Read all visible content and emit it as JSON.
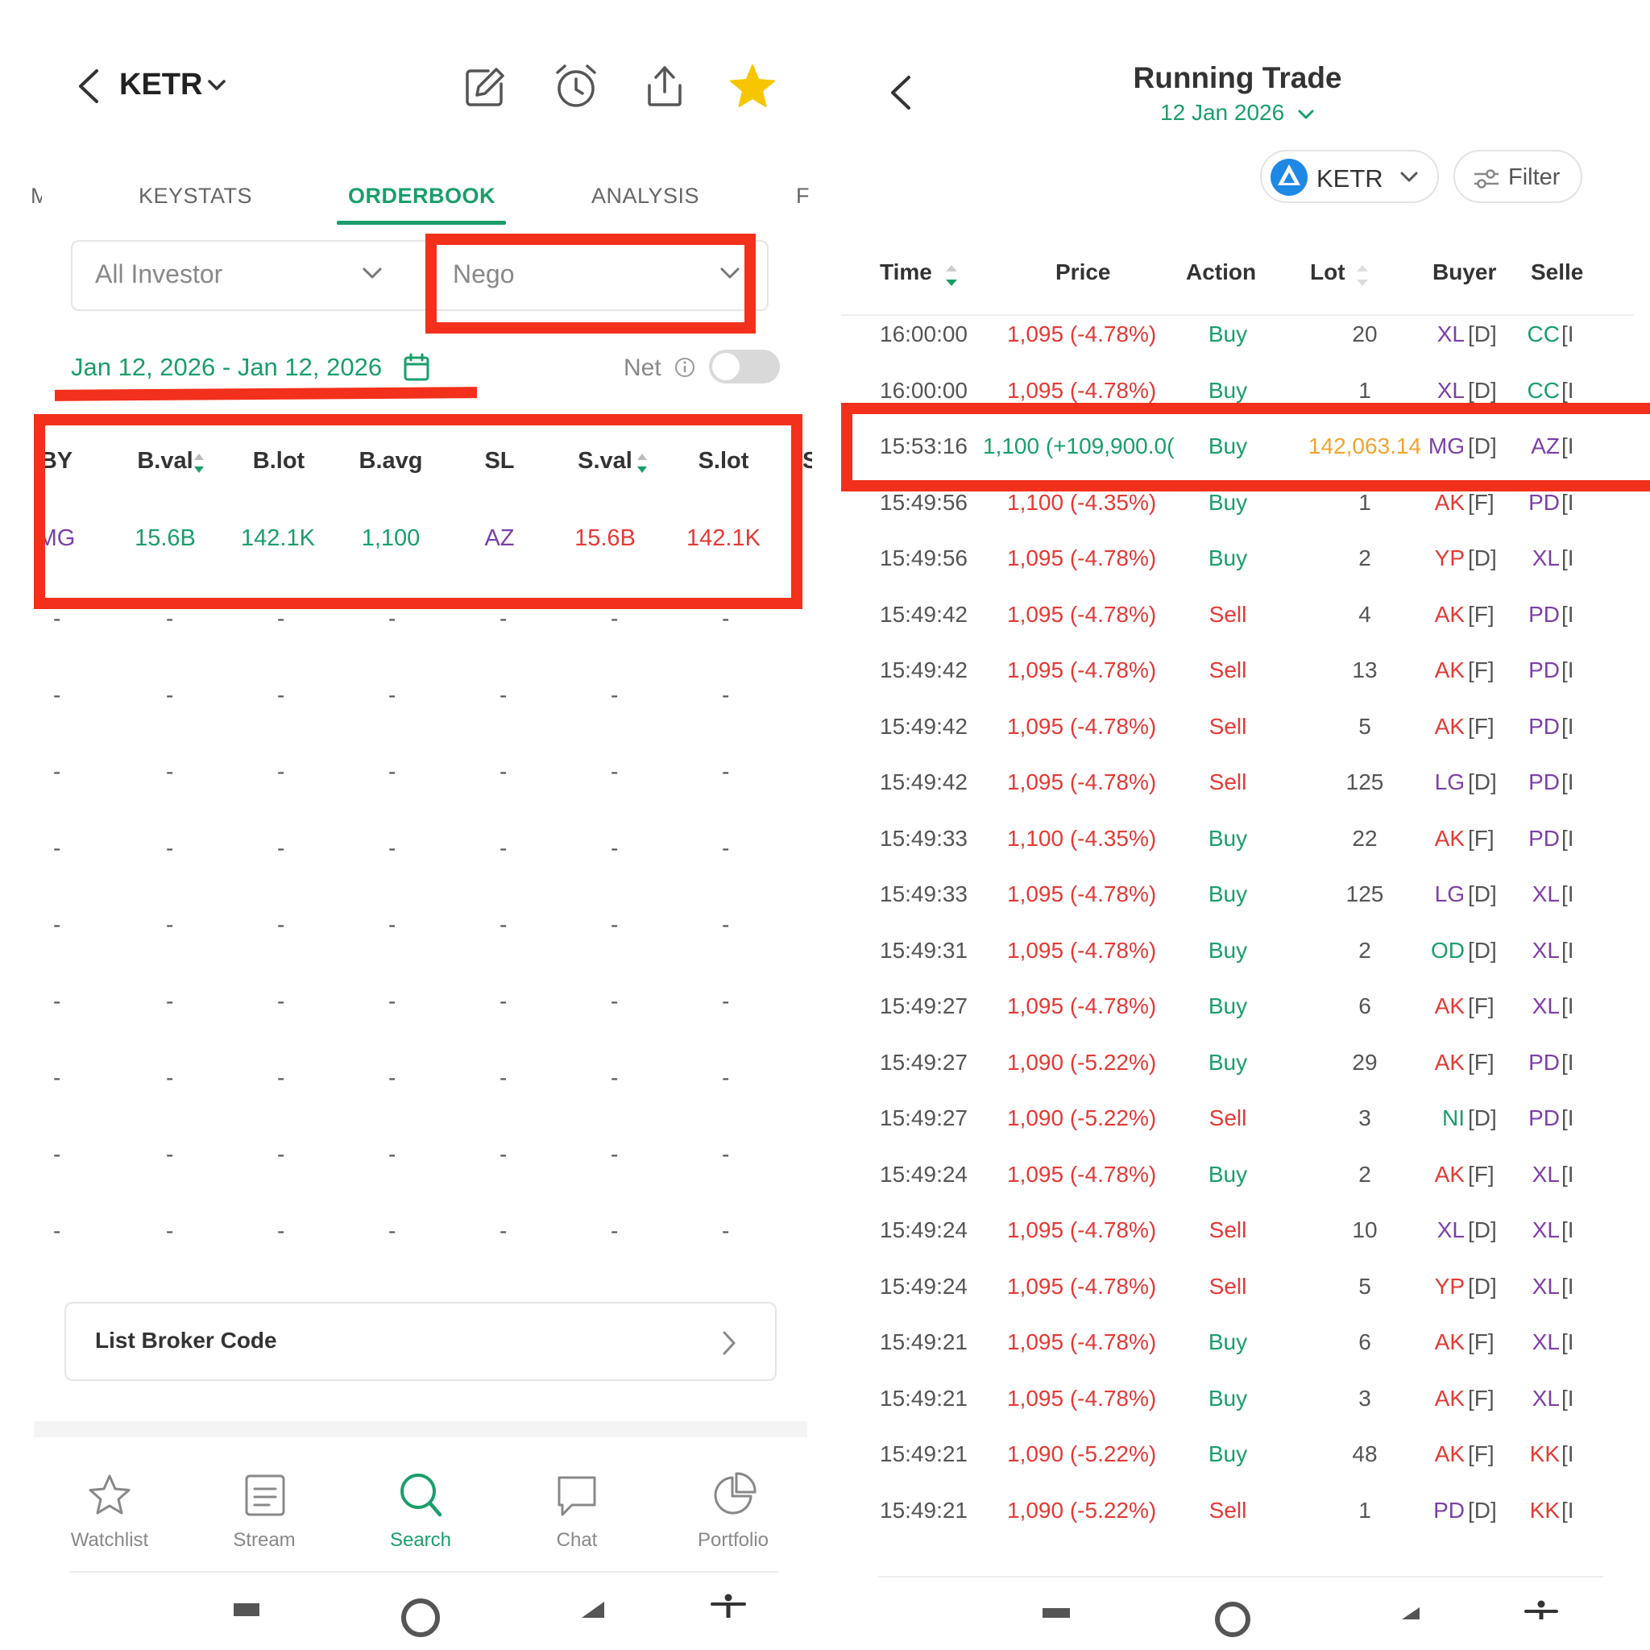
{
  "left": {
    "header": {
      "ticker": "KETR"
    },
    "tabs": [
      {
        "label": "M",
        "active": false
      },
      {
        "label": "KEYSTATS",
        "active": false
      },
      {
        "label": "ORDERBOOK",
        "active": true
      },
      {
        "label": "ANALYSIS",
        "active": false
      },
      {
        "label": "F",
        "active": false
      }
    ],
    "filters": {
      "investor": "All Investor",
      "market": "Nego"
    },
    "date_range": "Jan 12, 2026 - Jan 12, 2026",
    "net_label": "Net",
    "net_on": false,
    "table": {
      "headers": [
        "BY",
        "B.val",
        "B.lot",
        "B.avg",
        "SL",
        "S.val",
        "S.lot",
        "S"
      ],
      "row": [
        "MG",
        "15.6B",
        "142.1K",
        "1,100",
        "AZ",
        "15.6B",
        "142.1K"
      ],
      "dash": "-"
    },
    "list_broker_code": "List Broker Code",
    "nav": [
      {
        "label": "Watchlist",
        "icon": "star-outline-icon"
      },
      {
        "label": "Stream",
        "icon": "stream-icon"
      },
      {
        "label": "Search",
        "icon": "search-icon",
        "active": true
      },
      {
        "label": "Chat",
        "icon": "chat-icon"
      },
      {
        "label": "Portfolio",
        "icon": "pie-chart-icon"
      }
    ]
  },
  "right": {
    "title": "Running Trade",
    "date": "12 Jan 2026",
    "ticker_chip": "KETR",
    "filter_label": "Filter",
    "columns": [
      "Time",
      "Price",
      "Action",
      "Lot",
      "Buyer",
      "Selle"
    ],
    "rows": [
      {
        "time": "16:00:00",
        "price": "1,095 (-4.78%)",
        "action": "Buy",
        "lot": "20",
        "buyer": "XL",
        "buyer_type": "[D]",
        "seller": "CC",
        "seller_type": "[I"
      },
      {
        "time": "16:00:00",
        "price": "1,095 (-4.78%)",
        "action": "Buy",
        "lot": "1",
        "buyer": "XL",
        "buyer_type": "[D]",
        "seller": "CC",
        "seller_type": "[I"
      },
      {
        "time": "15:53:16",
        "price": "1,100 (+109,900.0(",
        "action": "Buy",
        "lot": "142,063.14",
        "buyer": "MG",
        "buyer_type": "[D]",
        "seller": "AZ",
        "seller_type": "[I",
        "highlight": true
      },
      {
        "time": "15:49:56",
        "price": "1,100 (-4.35%)",
        "action": "Buy",
        "lot": "1",
        "buyer": "AK",
        "buyer_type": "[F]",
        "seller": "PD",
        "seller_type": "[I"
      },
      {
        "time": "15:49:56",
        "price": "1,095 (-4.78%)",
        "action": "Buy",
        "lot": "2",
        "buyer": "YP",
        "buyer_type": "[D]",
        "seller": "XL",
        "seller_type": "[I"
      },
      {
        "time": "15:49:42",
        "price": "1,095 (-4.78%)",
        "action": "Sell",
        "lot": "4",
        "buyer": "AK",
        "buyer_type": "[F]",
        "seller": "PD",
        "seller_type": "[I"
      },
      {
        "time": "15:49:42",
        "price": "1,095 (-4.78%)",
        "action": "Sell",
        "lot": "13",
        "buyer": "AK",
        "buyer_type": "[F]",
        "seller": "PD",
        "seller_type": "[I"
      },
      {
        "time": "15:49:42",
        "price": "1,095 (-4.78%)",
        "action": "Sell",
        "lot": "5",
        "buyer": "AK",
        "buyer_type": "[F]",
        "seller": "PD",
        "seller_type": "[I"
      },
      {
        "time": "15:49:42",
        "price": "1,095 (-4.78%)",
        "action": "Sell",
        "lot": "125",
        "buyer": "LG",
        "buyer_type": "[D]",
        "seller": "PD",
        "seller_type": "[I"
      },
      {
        "time": "15:49:33",
        "price": "1,100 (-4.35%)",
        "action": "Buy",
        "lot": "22",
        "buyer": "AK",
        "buyer_type": "[F]",
        "seller": "PD",
        "seller_type": "[I"
      },
      {
        "time": "15:49:33",
        "price": "1,095 (-4.78%)",
        "action": "Buy",
        "lot": "125",
        "buyer": "LG",
        "buyer_type": "[D]",
        "seller": "XL",
        "seller_type": "[I"
      },
      {
        "time": "15:49:31",
        "price": "1,095 (-4.78%)",
        "action": "Buy",
        "lot": "2",
        "buyer": "OD",
        "buyer_type": "[D]",
        "seller": "XL",
        "seller_type": "[I"
      },
      {
        "time": "15:49:27",
        "price": "1,095 (-4.78%)",
        "action": "Buy",
        "lot": "6",
        "buyer": "AK",
        "buyer_type": "[F]",
        "seller": "XL",
        "seller_type": "[I"
      },
      {
        "time": "15:49:27",
        "price": "1,090 (-5.22%)",
        "action": "Buy",
        "lot": "29",
        "buyer": "AK",
        "buyer_type": "[F]",
        "seller": "PD",
        "seller_type": "[I"
      },
      {
        "time": "15:49:27",
        "price": "1,090 (-5.22%)",
        "action": "Sell",
        "lot": "3",
        "buyer": "NI",
        "buyer_type": "[D]",
        "seller": "PD",
        "seller_type": "[I"
      },
      {
        "time": "15:49:24",
        "price": "1,095 (-4.78%)",
        "action": "Buy",
        "lot": "2",
        "buyer": "AK",
        "buyer_type": "[F]",
        "seller": "XL",
        "seller_type": "[I"
      },
      {
        "time": "15:49:24",
        "price": "1,095 (-4.78%)",
        "action": "Sell",
        "lot": "10",
        "buyer": "XL",
        "buyer_type": "[D]",
        "seller": "XL",
        "seller_type": "[I"
      },
      {
        "time": "15:49:24",
        "price": "1,095 (-4.78%)",
        "action": "Sell",
        "lot": "5",
        "buyer": "YP",
        "buyer_type": "[D]",
        "seller": "XL",
        "seller_type": "[I"
      },
      {
        "time": "15:49:21",
        "price": "1,095 (-4.78%)",
        "action": "Buy",
        "lot": "6",
        "buyer": "AK",
        "buyer_type": "[F]",
        "seller": "XL",
        "seller_type": "[I"
      },
      {
        "time": "15:49:21",
        "price": "1,095 (-4.78%)",
        "action": "Buy",
        "lot": "3",
        "buyer": "AK",
        "buyer_type": "[F]",
        "seller": "XL",
        "seller_type": "[I"
      },
      {
        "time": "15:49:21",
        "price": "1,090 (-5.22%)",
        "action": "Buy",
        "lot": "48",
        "buyer": "AK",
        "buyer_type": "[F]",
        "seller": "KK",
        "seller_type": "[I"
      },
      {
        "time": "15:49:21",
        "price": "1,090 (-5.22%)",
        "action": "Sell",
        "lot": "1",
        "buyer": "PD",
        "buyer_type": "[D]",
        "seller": "KK",
        "seller_type": "[I"
      }
    ]
  },
  "colors": {
    "green": "#1a9e6a",
    "red": "#e53935",
    "purple": "#7b3fa8",
    "orange": "#f0a430",
    "annotation_red": "#f2301b",
    "star_yellow": "#f7c600"
  },
  "broker_colors": {
    "XL": "purple",
    "CC": "green",
    "MG": "purple",
    "AZ": "purple",
    "AK": "red",
    "PD": "purple",
    "YP": "red",
    "LG": "purple",
    "OD": "green",
    "NI": "green",
    "KK": "red"
  }
}
